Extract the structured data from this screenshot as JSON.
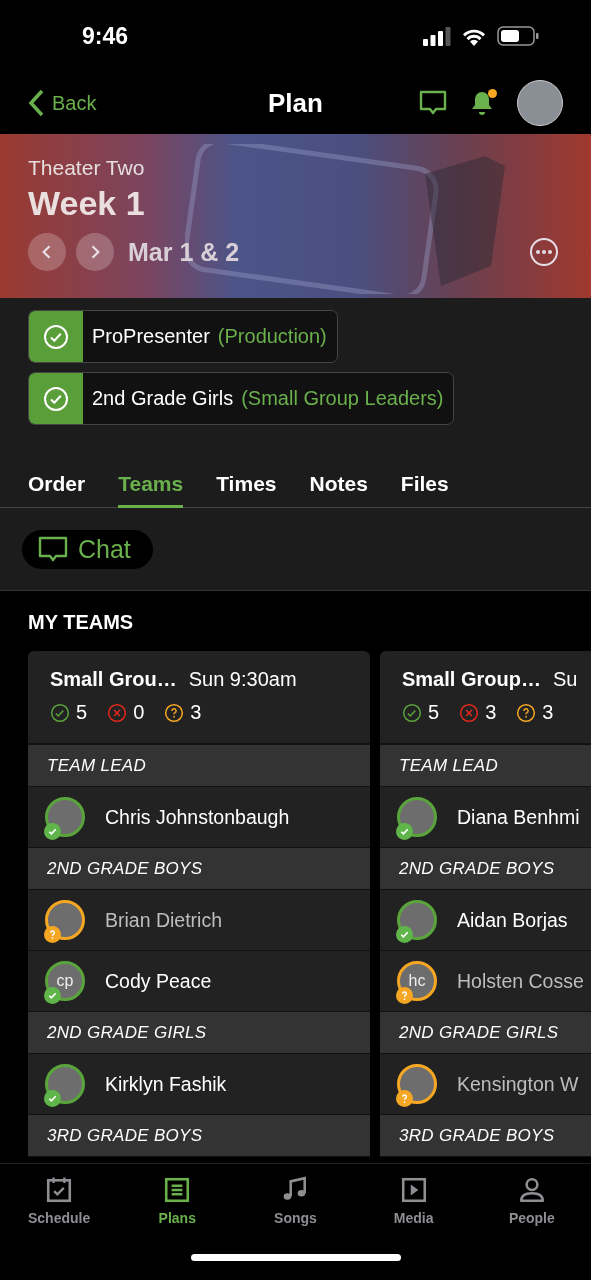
{
  "status_bar": {
    "time": "9:46"
  },
  "nav": {
    "back": "Back",
    "title": "Plan",
    "unread_notifications": true
  },
  "header": {
    "subtitle": "Theater Two",
    "title": "Week 1",
    "dates": "Mar 1 & 2"
  },
  "assignments": [
    {
      "name": "ProPresenter",
      "team": "(Production)",
      "confirmed": true
    },
    {
      "name": "2nd Grade Girls",
      "team": "(Small Group Leaders)",
      "confirmed": true
    }
  ],
  "tabs": [
    {
      "label": "Order",
      "selected": false
    },
    {
      "label": "Teams",
      "selected": true
    },
    {
      "label": "Times",
      "selected": false
    },
    {
      "label": "Notes",
      "selected": false
    },
    {
      "label": "Files",
      "selected": false
    }
  ],
  "chat_button": "Chat",
  "my_teams": {
    "heading": "MY TEAMS",
    "cards": [
      {
        "title": "Small Grou…",
        "time": "Sun 9:30am",
        "counts": [
          {
            "kind": "confirmed",
            "value": "5"
          },
          {
            "kind": "declined",
            "value": "0"
          },
          {
            "kind": "pending",
            "value": "3"
          }
        ],
        "sections": [
          {
            "name": "TEAM LEAD",
            "people": [
              {
                "name": "Chris Johnstonbaugh",
                "confirmed": true
              }
            ]
          },
          {
            "name": "2ND GRADE BOYS",
            "people": [
              {
                "name": "Brian Dietrich",
                "confirmed": false
              },
              {
                "name": "Cody Peace",
                "confirmed": true,
                "initials": "cp"
              }
            ]
          },
          {
            "name": "2ND GRADE GIRLS",
            "people": [
              {
                "name": "Kirklyn Fashik",
                "confirmed": true
              }
            ]
          },
          {
            "name": "3RD GRADE BOYS"
          }
        ]
      },
      {
        "title": "Small Group…",
        "time": "Su",
        "counts": [
          {
            "kind": "confirmed",
            "value": "5"
          },
          {
            "kind": "declined",
            "value": "3"
          },
          {
            "kind": "pending",
            "value": "3"
          }
        ],
        "sections": [
          {
            "name": "TEAM LEAD",
            "people": [
              {
                "name": "Diana Benhmi",
                "confirmed": true
              }
            ]
          },
          {
            "name": "2ND GRADE BOYS",
            "people": [
              {
                "name": "Aidan Borjas",
                "confirmed": true
              },
              {
                "name": "Holsten Cosse",
                "confirmed": false,
                "initials": "hc"
              }
            ]
          },
          {
            "name": "2ND GRADE GIRLS",
            "people": [
              {
                "name": "Kensington W",
                "confirmed": false
              }
            ]
          },
          {
            "name": "3RD GRADE BOYS"
          }
        ]
      }
    ]
  },
  "tab_bar": [
    {
      "label": "Schedule",
      "selected": false
    },
    {
      "label": "Plans",
      "selected": true
    },
    {
      "label": "Songs",
      "selected": false
    },
    {
      "label": "Media",
      "selected": false
    },
    {
      "label": "People",
      "selected": false
    }
  ]
}
